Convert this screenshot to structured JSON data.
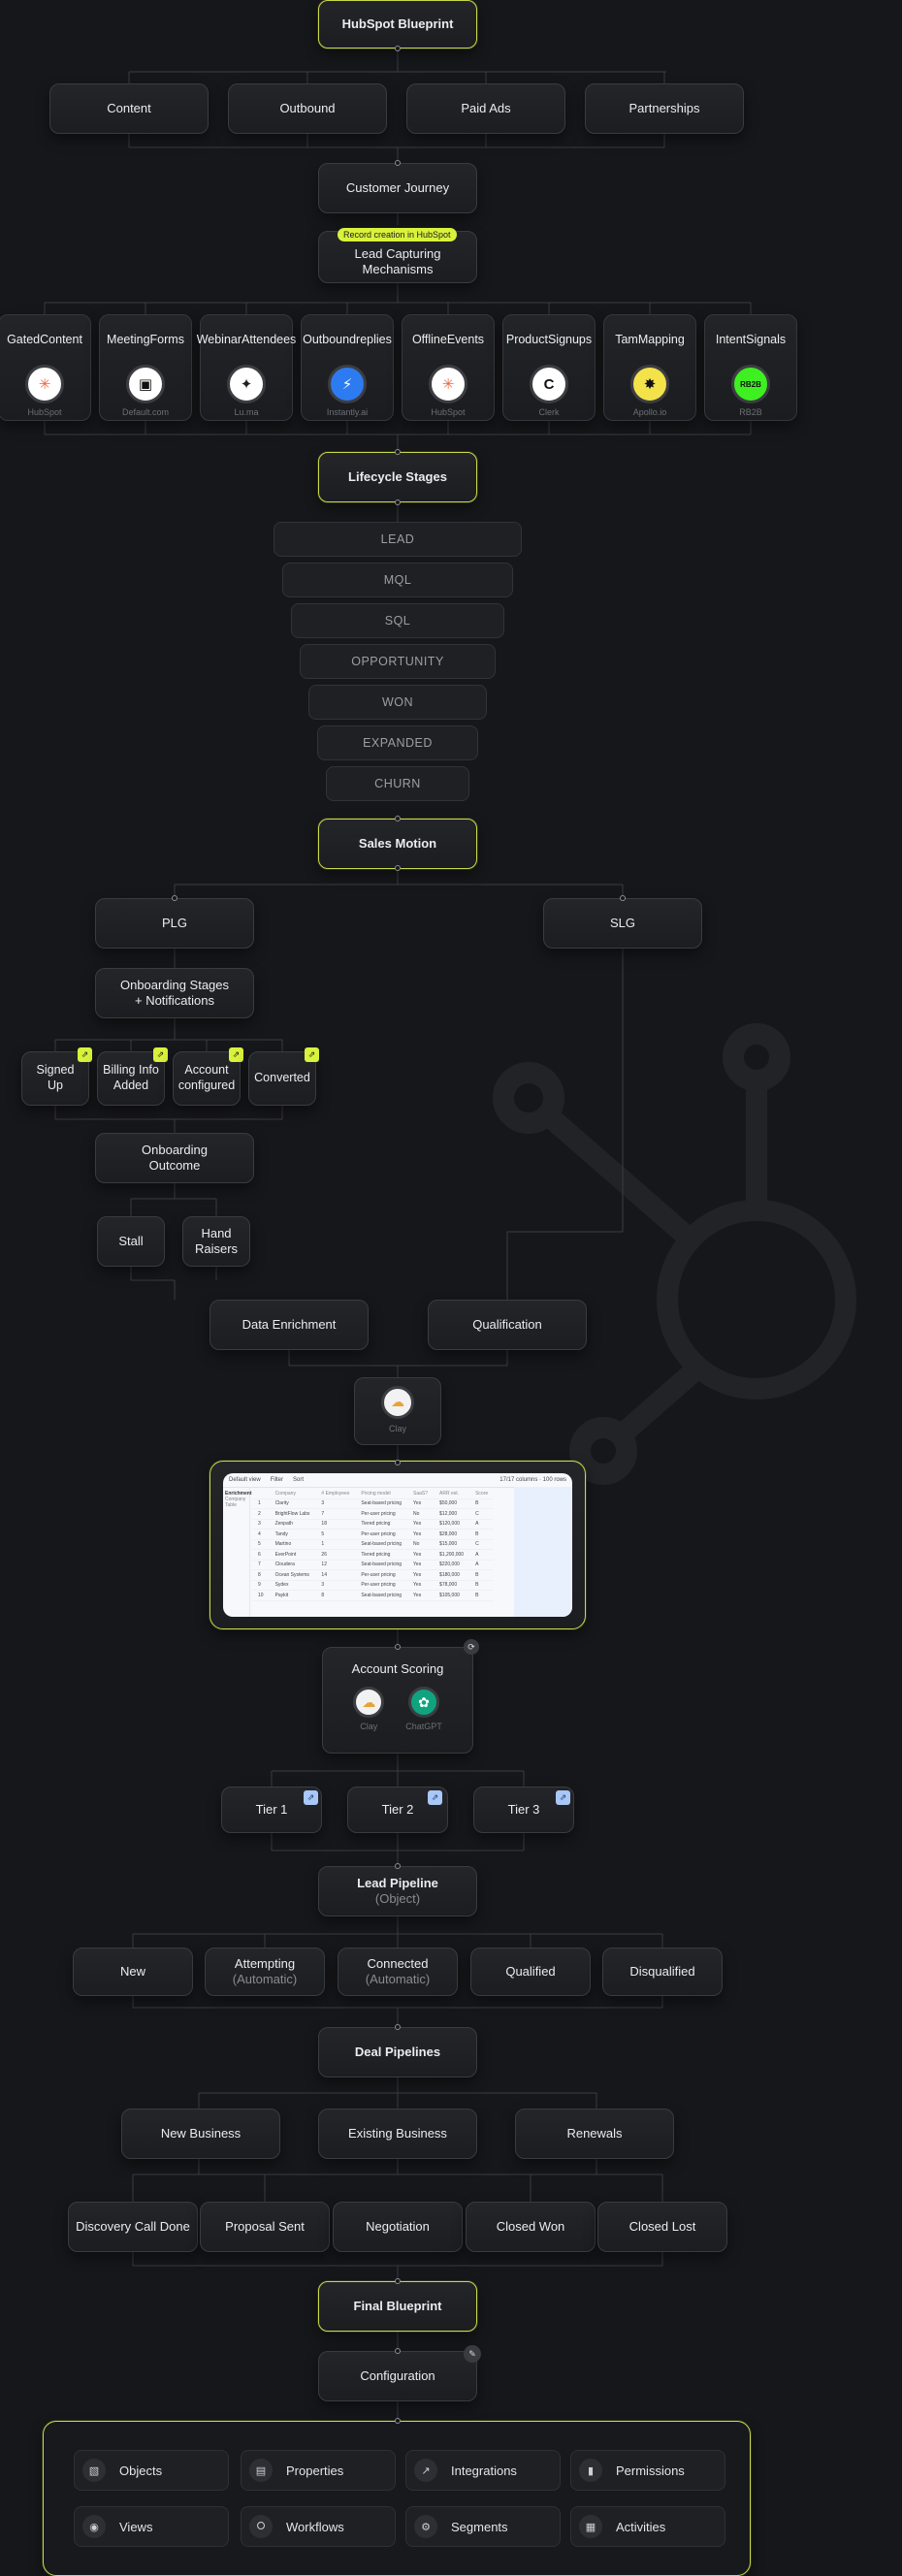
{
  "title": "HubSpot Blueprint",
  "channels": [
    "Content",
    "Outbound",
    "Paid Ads",
    "Partnerships"
  ],
  "customer_journey": "Customer Journey",
  "record_badge": "Record creation in HubSpot",
  "lead_capture": [
    "Lead Capturing",
    "Mechanisms"
  ],
  "sources": [
    {
      "title": [
        "Gated",
        "Content"
      ],
      "tool": "HubSpot",
      "icon": "hubspot-icon",
      "color": "#f3643c",
      "bg": "#ffffff",
      "glyph": "✳"
    },
    {
      "title": [
        "Meeting",
        "Forms"
      ],
      "tool": "Default.com",
      "icon": "default-icon",
      "color": "#111111",
      "bg": "#ffffff",
      "glyph": "▣"
    },
    {
      "title": [
        "Webinar",
        "Attendees"
      ],
      "tool": "Lu.ma",
      "icon": "luma-icon",
      "color": "#222222",
      "bg": "#ffffff",
      "glyph": "✦"
    },
    {
      "title": [
        "Outbound",
        "replies"
      ],
      "tool": "Instantly.ai",
      "icon": "instantly-icon",
      "color": "#ffffff",
      "bg": "#2d7bf0",
      "glyph": "⚡"
    },
    {
      "title": [
        "Offline",
        "Events"
      ],
      "tool": "HubSpot",
      "icon": "hubspot-icon",
      "color": "#f3643c",
      "bg": "#ffffff",
      "glyph": "✳"
    },
    {
      "title": [
        "Product",
        "Signups"
      ],
      "tool": "Clerk",
      "icon": "clerk-icon",
      "color": "#111111",
      "bg": "#ffffff",
      "glyph": "C"
    },
    {
      "title": [
        "Tam",
        "Mapping"
      ],
      "tool": "Apollo.io",
      "icon": "apollo-icon",
      "color": "#111111",
      "bg": "#f4e24a",
      "glyph": "✸"
    },
    {
      "title": [
        "Intent",
        "Signals"
      ],
      "tool": "RB2B",
      "icon": "rb2b-icon",
      "color": "#111111",
      "bg": "#3ef021",
      "glyph": "RB2B"
    }
  ],
  "lifecycle": "Lifecycle Stages",
  "stages": [
    "LEAD",
    "MQL",
    "SQL",
    "OPPORTUNITY",
    "WON",
    "EXPANDED",
    "CHURN"
  ],
  "sales_motion": "Sales Motion",
  "plg": "PLG",
  "slg": "SLG",
  "onboarding": [
    "Onboarding Stages",
    "+ Notifications"
  ],
  "onboarding_steps": [
    [
      "Signed",
      "Up"
    ],
    [
      "Billing Info",
      "Added"
    ],
    [
      "Account",
      "configured"
    ],
    [
      "Converted"
    ]
  ],
  "onboarding_outcome": [
    "Onboarding",
    "Outcome"
  ],
  "outcomes": [
    [
      "Stall"
    ],
    [
      "Hand",
      "Raisers"
    ]
  ],
  "enrichment": "Data Enrichment",
  "qualification": "Qualification",
  "clay": "Clay",
  "sheet": {
    "header": [
      "Default view",
      "Filter",
      "Sort",
      "17/17 columns · 100 rows"
    ],
    "side": [
      "Enrichment",
      "Company Table"
    ],
    "columns": [
      "Company",
      "# Employees",
      "Pricing model",
      "SaaS?",
      "ARR est.",
      "Score"
    ],
    "rows": [
      [
        "Clarity",
        "3",
        "Seat-based pricing",
        "Yes",
        "$50,000",
        "B"
      ],
      [
        "BrightFlow Labs",
        "7",
        "Per-user pricing",
        "No",
        "$12,000",
        "C"
      ],
      [
        "Zenpath",
        "18",
        "Tiered pricing",
        "Yes",
        "$120,000",
        "A"
      ],
      [
        "Tandy",
        "5",
        "Per-user pricing",
        "Yes",
        "$28,000",
        "B"
      ],
      [
        "Martino",
        "1",
        "Seat-based pricing",
        "No",
        "$15,000",
        "C"
      ],
      [
        "EverPoint",
        "26",
        "Tiered pricing",
        "Yes",
        "$1,200,000",
        "A"
      ],
      [
        "Cloudera",
        "12",
        "Seat-based pricing",
        "Yes",
        "$220,000",
        "A"
      ],
      [
        "Ocean Systems",
        "14",
        "Per-user pricing",
        "Yes",
        "$180,000",
        "B"
      ],
      [
        "Sydex",
        "3",
        "Per-user pricing",
        "Yes",
        "$78,000",
        "B"
      ],
      [
        "Paykit",
        "8",
        "Seat-based pricing",
        "Yes",
        "$105,000",
        "B"
      ]
    ]
  },
  "account_scoring": "Account Scoring",
  "scoring_tools": [
    {
      "name": "Clay",
      "icon": "clay-icon"
    },
    {
      "name": "ChatGPT",
      "icon": "chatgpt-icon"
    }
  ],
  "tiers": [
    "Tier 1",
    "Tier 2",
    "Tier 3"
  ],
  "lead_pipeline": [
    "Lead Pipeline",
    "(Object)"
  ],
  "lead_stages": [
    {
      "t": "New",
      "s": ""
    },
    {
      "t": "Attempting",
      "s": "(Automatic)"
    },
    {
      "t": "Connected",
      "s": "(Automatic)"
    },
    {
      "t": "Qualified",
      "s": ""
    },
    {
      "t": "Disqualified",
      "s": ""
    }
  ],
  "deal_pipelines": "Deal Pipelines",
  "deal_types": [
    "New Business",
    "Existing Business",
    "Renewals"
  ],
  "deal_stages": [
    "Discovery Call Done",
    "Proposal Sent",
    "Negotiation",
    "Closed Won",
    "Closed Lost"
  ],
  "final": "Final Blueprint",
  "configuration": "Configuration",
  "config_items": [
    {
      "label": "Objects",
      "icon": "objects-icon",
      "glyph": "▧"
    },
    {
      "label": "Properties",
      "icon": "properties-icon",
      "glyph": "▤"
    },
    {
      "label": "Integrations",
      "icon": "integrations-icon",
      "glyph": "↗"
    },
    {
      "label": "Permissions",
      "icon": "permissions-icon",
      "glyph": "▮"
    },
    {
      "label": "Views",
      "icon": "views-icon",
      "glyph": "◉"
    },
    {
      "label": "Workflows",
      "icon": "workflows-icon",
      "glyph": "⭘"
    },
    {
      "label": "Segments",
      "icon": "segments-icon",
      "glyph": "⚙"
    },
    {
      "label": "Activities",
      "icon": "activities-icon",
      "glyph": "▦"
    }
  ],
  "colors": {
    "accent": "#d9f23b",
    "highlight_border": "#c9d94a",
    "tier_tag": "#a9c8f7",
    "background": "#16171a"
  }
}
